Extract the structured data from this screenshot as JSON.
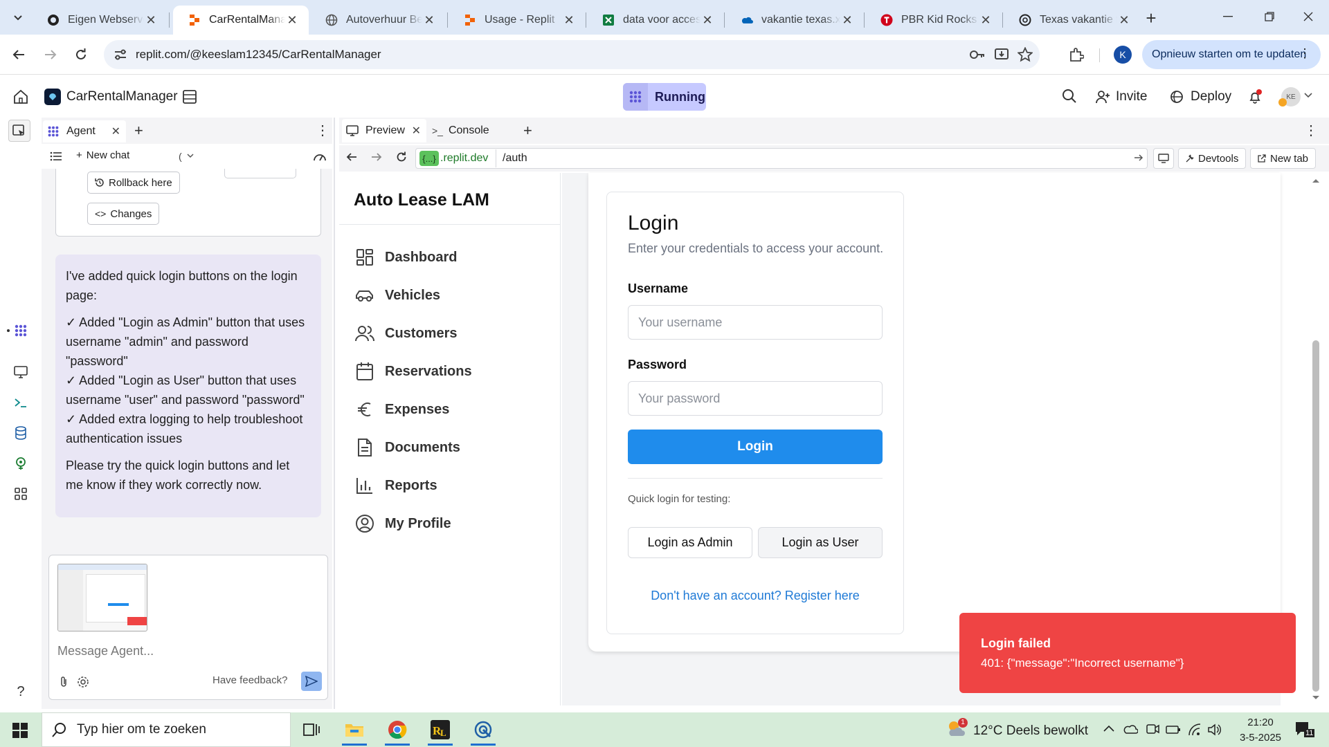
{
  "browser": {
    "tabs": [
      {
        "title": "Eigen Webserver",
        "icon": "github-icon"
      },
      {
        "title": "CarRentalManager",
        "icon": "replit-icon",
        "active": true
      },
      {
        "title": "Autoverhuur Beheer",
        "icon": "globe-icon"
      },
      {
        "title": "Usage - Replit",
        "icon": "replit-icon"
      },
      {
        "title": "data voor access",
        "icon": "excel-icon"
      },
      {
        "title": "vakantie texas.xlsx",
        "icon": "onedrive-icon"
      },
      {
        "title": "PBR Kid Rocks Rock",
        "icon": "pbr-icon"
      },
      {
        "title": "Texas vakantie tips",
        "icon": "chatgpt-icon"
      }
    ],
    "url": "replit.com/@keeslam12345/CarRentalManager",
    "update_button": "Opnieuw starten om te updaten",
    "profile_initial": "K"
  },
  "replit": {
    "project_name": "CarRentalManager",
    "status": "Running",
    "invite": "Invite",
    "deploy": "Deploy",
    "avatar_initials": "KE"
  },
  "agent": {
    "tab_label": "Agent",
    "new_chat": "New chat",
    "rollback": "Rollback here",
    "changes": "Changes",
    "message": {
      "intro": "I've added quick login buttons on the login page:",
      "line1": "✓ Added \"Login as Admin\" button that uses username \"admin\" and password \"password\"",
      "line2": "✓ Added \"Login as User\" button that uses username \"user\" and password \"password\"",
      "line3": "✓ Added extra logging to help troubleshoot authentication issues",
      "outro": "Please try the quick login buttons and let me know if they work correctly now."
    },
    "composer_placeholder": "Message Agent...",
    "feedback": "Have feedback?"
  },
  "workspace": {
    "tabs": [
      "Preview",
      "Console"
    ],
    "domain_chip": "{...}",
    "domain": ".replit.dev",
    "path": "/auth",
    "devtools": "Devtools",
    "new_tab": "New tab"
  },
  "app": {
    "brand": "Auto Lease LAM",
    "nav": [
      {
        "label": "Dashboard",
        "icon": "dashboard-icon"
      },
      {
        "label": "Vehicles",
        "icon": "car-icon"
      },
      {
        "label": "Customers",
        "icon": "users-icon"
      },
      {
        "label": "Reservations",
        "icon": "calendar-icon"
      },
      {
        "label": "Expenses",
        "icon": "euro-icon"
      },
      {
        "label": "Documents",
        "icon": "document-icon"
      },
      {
        "label": "Reports",
        "icon": "bar-chart-icon"
      },
      {
        "label": "My Profile",
        "icon": "profile-icon"
      }
    ],
    "login": {
      "title": "Login",
      "subtitle": "Enter your credentials to access your account.",
      "username_label": "Username",
      "username_placeholder": "Your username",
      "password_label": "Password",
      "password_placeholder": "Your password",
      "submit": "Login",
      "quick_label": "Quick login for testing:",
      "admin_button": "Login as Admin",
      "user_button": "Login as User",
      "register_link": "Don't have an account? Register here"
    },
    "toast": {
      "title": "Login failed",
      "message": "401: {\"message\":\"Incorrect username\"}"
    }
  },
  "taskbar": {
    "search_placeholder": "Typ hier om te zoeken",
    "weather": "12°C  Deels bewolkt",
    "weather_badge": "1",
    "time": "21:20",
    "date": "3-5-2025",
    "notification_count": "11"
  }
}
